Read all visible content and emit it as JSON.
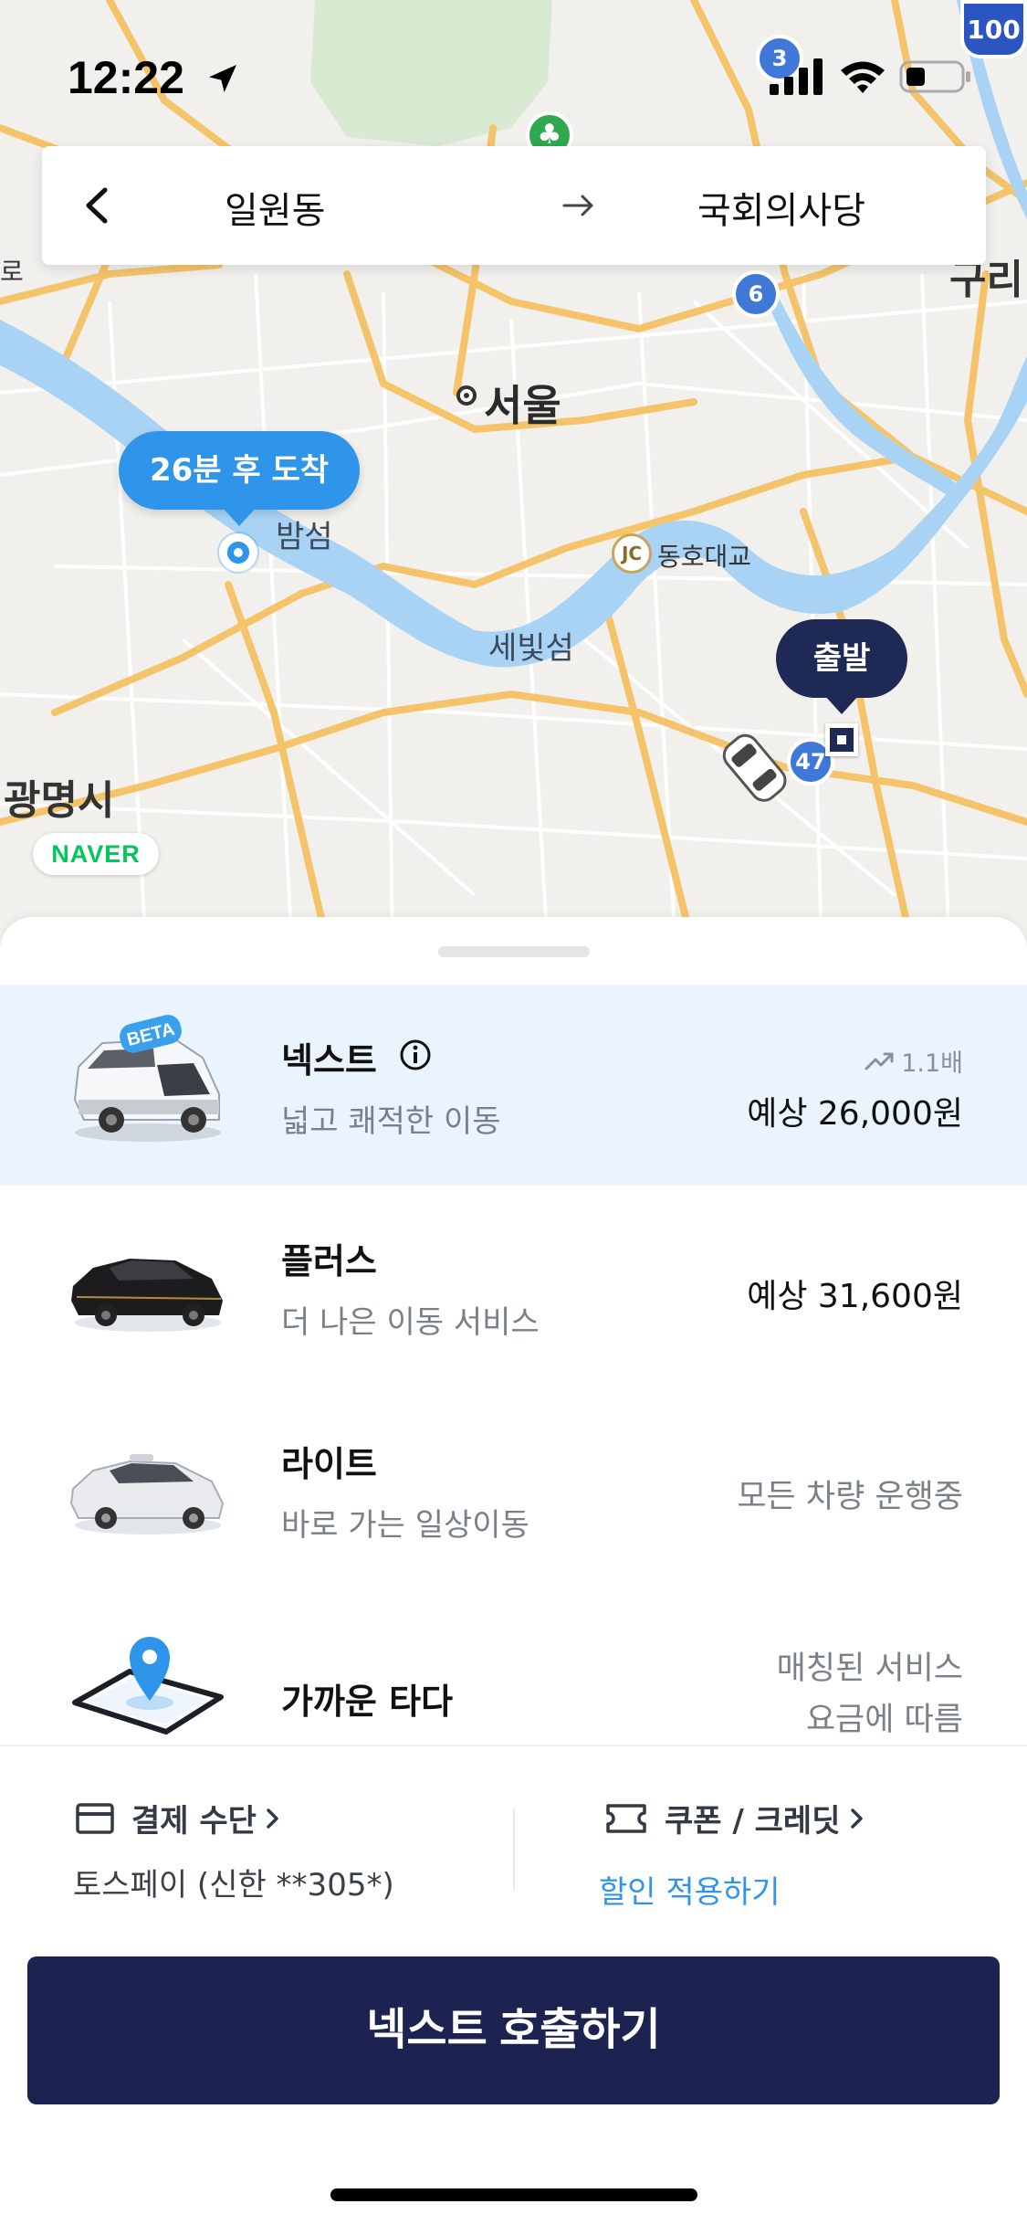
{
  "status_bar": {
    "time": "12:22",
    "icons": [
      "location-arrow-icon",
      "cellular-signal-icon",
      "wifi-icon",
      "battery-icon"
    ]
  },
  "map": {
    "labels": {
      "seoul": "서울",
      "bamseom": "밤섬",
      "saebitseom": "세빛섬",
      "dongho_bridge": "동호대교",
      "gwangmyeong": "광명시",
      "guri": "구리",
      "ro": "로"
    },
    "jc_badge": "JC",
    "route_badges": [
      "3",
      "6",
      "47"
    ],
    "highway_shield": "100",
    "arrival_bubble": "26분 후 도착",
    "departure_bubble": "출발",
    "provider_logo": "NAVER",
    "colors": {
      "water": "#a9d3f5",
      "road_major": "#f5c46a",
      "road_minor": "#ffffff",
      "land": "#f1f0ec",
      "park": "#d9ead3"
    }
  },
  "route": {
    "origin": "일원동 ",
    "destination": "국회의사당",
    "icons": [
      "back-chevron-icon",
      "arrow-right-icon"
    ]
  },
  "ride_options": [
    {
      "name": "넥스트",
      "subtitle": "넓고 쾌적한 이동",
      "price": "예상 26,000원",
      "surge": "1.1배",
      "badge": "BETA",
      "selected": true
    },
    {
      "name": "플러스",
      "subtitle": "더 나은 이동 서비스",
      "price": "예상 31,600원",
      "selected": false
    },
    {
      "name": "라이트",
      "subtitle": "바로 가는 일상이동",
      "status": "모든 차량 운행중",
      "selected": false
    },
    {
      "name": "가까운 타다",
      "status_line1": "매칭된 서비스",
      "status_line2": "요금에 따름",
      "selected": false
    }
  ],
  "payment": {
    "method_label": "결제 수단",
    "method_value": "토스페이 (신한 **305*)",
    "coupon_label": "쿠폰 / 크레딧",
    "coupon_value": "할인 적용하기"
  },
  "cta": {
    "label": "넥스트 호출하기"
  },
  "colors": {
    "accent": "#2f95ea",
    "navy": "#1d2350",
    "selected_bg": "#eaf4fe",
    "link": "#2f95ea"
  }
}
